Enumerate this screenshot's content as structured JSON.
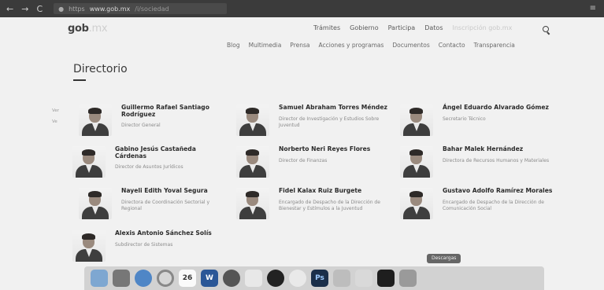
{
  "browser": {
    "nav_back": "←",
    "nav_forward": "→",
    "nav_reload": "C",
    "url_https": "https",
    "url_domain": "www.gob.mx",
    "url_path": "/i/sociedad",
    "menu_icon": "≡"
  },
  "header": {
    "logo": "gob",
    "logo_suffix": ".mx",
    "top_nav": [
      "Trámites",
      "Gobierno",
      "Participa",
      "Datos"
    ],
    "faint_link": "Inscripción gob.mx",
    "sub_nav": [
      "Blog",
      "Multimedia",
      "Prensa",
      "Acciones y programas",
      "Documentos",
      "Contacto",
      "Transparencia"
    ]
  },
  "page": {
    "title": "Directorio",
    "pager": [
      "Ver",
      "Ve"
    ]
  },
  "people": [
    {
      "name": "Guillermo Rafael Santiago Rodríguez",
      "role": "Director General"
    },
    {
      "name": "Samuel Abraham Torres Méndez",
      "role": "Director de Investigación y Estudios Sobre Juventud"
    },
    {
      "name": "Ángel Eduardo Alvarado Gómez",
      "role": "Secretario Técnico"
    },
    {
      "name": "Gabino Jesús Castañeda Cárdenas",
      "role": "Director de Asuntos Jurídicos"
    },
    {
      "name": "Norberto Neri Reyes Flores",
      "role": "Director de Finanzas"
    },
    {
      "name": "Bahar Malek Hernández",
      "role": "Directora de Recursos Humanos y Materiales"
    },
    {
      "name": "Nayeli Edith Yoval Segura",
      "role": "Directora de Coordinación Sectorial y Regional"
    },
    {
      "name": "Fidel Kalax Ruiz Burgete",
      "role": "Encargado de Despacho de la Dirección de Bienestar y Estímulos a la Juventud"
    },
    {
      "name": "Gustavo Adolfo Ramírez Morales",
      "role": "Encargado de Despacho de la Dirección de Comunicación Social"
    },
    {
      "name": "Alexis Antonio Sánchez Solís",
      "role": "Subdirector de Sistemas"
    }
  ],
  "dock": {
    "tooltip": "Descargas",
    "calendar_day": "26",
    "word": "W",
    "photoshop": "Ps",
    "icons": [
      "finder-icon",
      "launchpad-icon",
      "safari-icon",
      "chrome-icon",
      "calendar-icon",
      "word-icon",
      "chrome-alt-icon",
      "notes-icon",
      "spotify-icon",
      "itunes-icon",
      "photoshop-icon",
      "preview-icon",
      "downloads-icon",
      "terminal-icon",
      "trash-icon"
    ]
  },
  "colors": {
    "browser_bar": "#3b3b3b",
    "page_bg": "#f1f1f1",
    "title": "#3a3a3a"
  }
}
